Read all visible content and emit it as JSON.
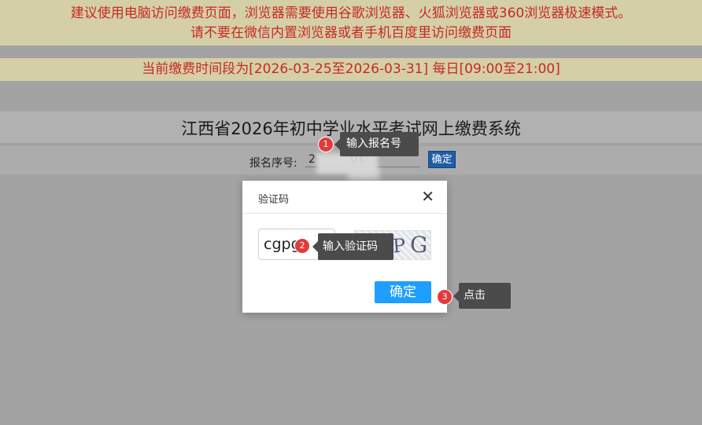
{
  "notices": {
    "line1": "建议使用电脑访问缴费页面，浏览器需要使用谷歌浏览器、火狐浏览器或360浏览器极速模式。",
    "line2": "请不要在微信内置浏览器或者手机百度里访问缴费页面",
    "period": "当前缴费时间段为[2026-03-25至2026-03-31] 每日[09:00至21:00]"
  },
  "page": {
    "title": "江西省2026年初中学业水平考试网上缴费系统"
  },
  "form": {
    "reg_label": "报名序号:",
    "reg_value": "2          01",
    "confirm_label": "确定"
  },
  "modal": {
    "title": "验证码",
    "close_icon": "close-icon",
    "captcha_value": "cgpg",
    "captcha_image_text": "cgPG",
    "confirm_label": "确定"
  },
  "annotations": [
    {
      "number": "1",
      "text": "输入报名号"
    },
    {
      "number": "2",
      "text": "输入验证码"
    },
    {
      "number": "3",
      "text": "点击"
    }
  ],
  "colors": {
    "notice_text": "#c62a21",
    "notice_bg": "#d5cfa8",
    "primary_button": "#1e9fff",
    "small_button": "#1f5ea5",
    "badge": "#e23a3a",
    "tooltip_bg": "#4b4b4b"
  }
}
